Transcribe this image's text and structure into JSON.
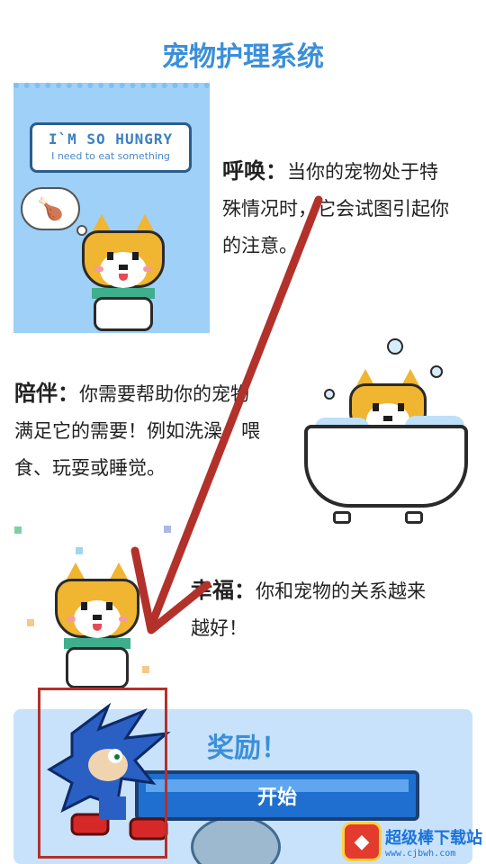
{
  "page": {
    "title": "宠物护理系统"
  },
  "hungry_card": {
    "title": "I`M SO HUNGRY",
    "subtitle": "I need to eat something"
  },
  "sections": {
    "call": {
      "label": "呼唤：",
      "lines": [
        "当你的宠物处于特",
        "殊情况时，它会试图引起你",
        "的注意。"
      ]
    },
    "companion": {
      "label": "陪伴：",
      "lines": [
        "你需要帮助你的宠物",
        "满足它的需要！例如洗澡、喂",
        "食、玩耍或睡觉。"
      ]
    },
    "happiness": {
      "label": "幸福：",
      "lines": [
        "你和宠物的关系越来",
        "越好！"
      ]
    }
  },
  "reward": {
    "title": "奖励！",
    "start_label": "开始"
  },
  "watermark": {
    "logo": "◆",
    "text": "超级棒下载站",
    "url": "www.cjbwh.com"
  },
  "colors": {
    "accent": "#3b8fd9",
    "arrow": "#b3312b",
    "button": "#1e6fcf"
  },
  "icons": {
    "thought": "drumstick-icon",
    "dog": "shiba-dog-icon",
    "character": "sonic-sprite-icon"
  }
}
